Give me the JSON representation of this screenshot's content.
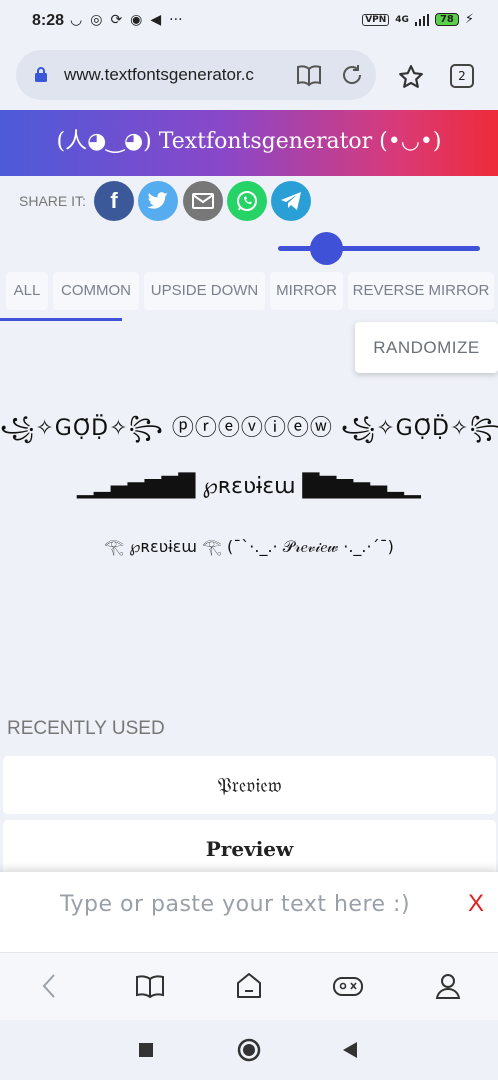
{
  "status": {
    "time": "8:28",
    "vpn": "VPN",
    "network": "4G",
    "battery": "78"
  },
  "browser": {
    "url": "www.textfontsgenerator.c",
    "tab_count": "2"
  },
  "banner": {
    "title": "(人◕‿◕) Textfontsgenerator (•◡•)"
  },
  "share": {
    "label": "SHARE IT:",
    "buttons": [
      {
        "name": "facebook",
        "glyph": "f",
        "color": "#3b5998"
      },
      {
        "name": "twitter",
        "glyph": "t",
        "color": "#55acee"
      },
      {
        "name": "email",
        "glyph": "✉",
        "color": "#777777"
      },
      {
        "name": "whatsapp",
        "glyph": "✆",
        "color": "#25d366"
      },
      {
        "name": "telegram",
        "glyph": "➤",
        "color": "#2a9fd6"
      }
    ]
  },
  "slider": {
    "value": 0.24
  },
  "tabs": [
    {
      "label": "ALL",
      "active": true
    },
    {
      "label": "COMMON"
    },
    {
      "label": "UPSIDE DOWN"
    },
    {
      "label": "MIRROR"
    },
    {
      "label": "REVERSE MIRROR"
    }
  ],
  "randomize_label": "RANDOMIZE",
  "preview_styles": [
    "꧁✧GỌ̈Ḍ̈✧꧂ ⓟⓡⓔⓥⓘⓔⓦ ꧁✧GỌ̈Ḍ̈✧꧂",
    "▁▂▄▅▆▇█ ℘ʀɛʋɨɛա █▇▆▅▄▂▁",
    "𓂀 ℘ʀɛʋɨɛա 𓂀    (¯`·._.· 𝒫𝓇𝑒𝓋𝒾𝑒𝓌 ·._.·´¯)"
  ],
  "recent": {
    "label": "RECENTLY USED",
    "items": [
      "𝔓𝔯𝔢𝔳𝔦𝔢𝔴",
      "𝐏𝐫𝐞𝐯𝐢𝐞𝐰"
    ]
  },
  "input": {
    "placeholder": "Type or paste your text here :)",
    "clear": "X"
  },
  "colors": {
    "accent": "#3f51d6",
    "clear": "#e02020"
  }
}
